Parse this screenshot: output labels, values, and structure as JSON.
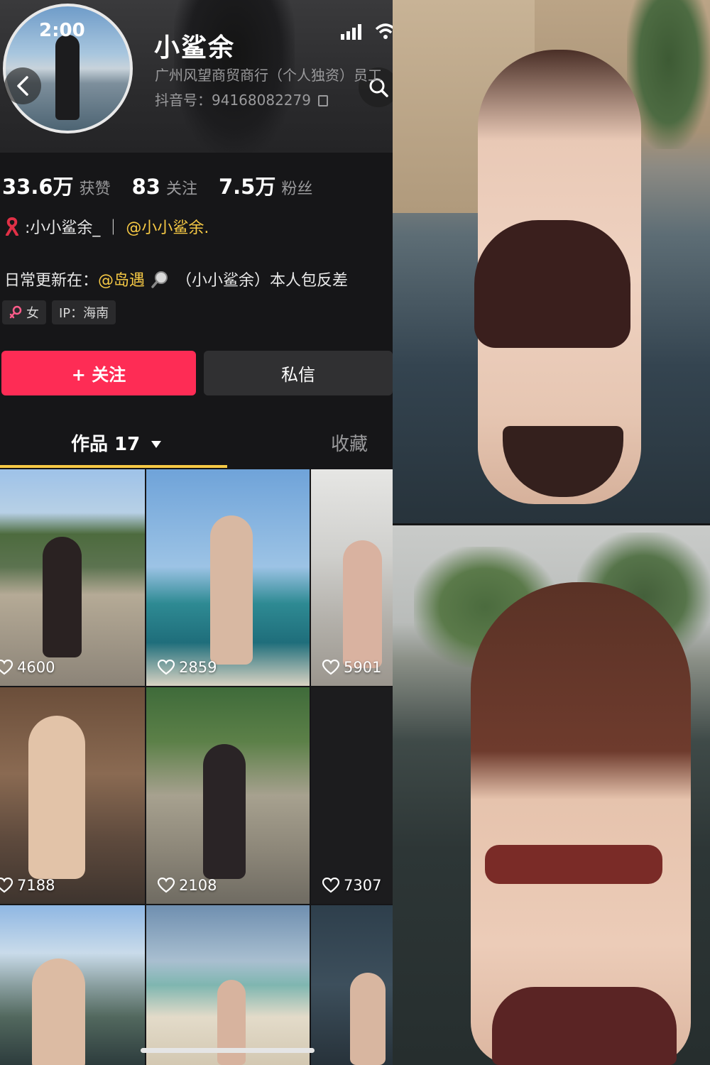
{
  "status_bar": {
    "time": "2:00"
  },
  "profile": {
    "username": "小鲨余",
    "company": "广州风望商贸商行（个人独资）员工",
    "douyin_id": "抖音号：94168082279"
  },
  "stats": [
    {
      "value": "33.6万",
      "label": "获赞"
    },
    {
      "value": "83",
      "label": "关注"
    },
    {
      "value": "7.5万",
      "label": "粉丝"
    }
  ],
  "bio": {
    "line1_prefix": ":小小鲨余_ ｜",
    "line1_mention": "@小小鲨余.",
    "line2_prefix": "日常更新在：",
    "line2_mention": "@岛遇",
    "line2_suffix": "（小小鲨余）本人包反差"
  },
  "tags": [
    {
      "icon": "female-icon",
      "label": "女"
    },
    {
      "label": "IP：海南"
    }
  ],
  "buttons": {
    "follow": "+ 关注",
    "message": "私信"
  },
  "tabs": {
    "works": "作品 17",
    "favorites": "收藏"
  },
  "videos": [
    {
      "likes": "4600"
    },
    {
      "likes": "2859"
    },
    {
      "likes": "5901"
    },
    {
      "likes": "7188"
    },
    {
      "likes": "2108"
    },
    {
      "likes": "7307"
    },
    {
      "likes": ""
    },
    {
      "likes": ""
    },
    {
      "likes": ""
    }
  ],
  "colors": {
    "accent_red": "#fe2c55",
    "mention_yellow": "#f6c945",
    "background": "#161618"
  }
}
